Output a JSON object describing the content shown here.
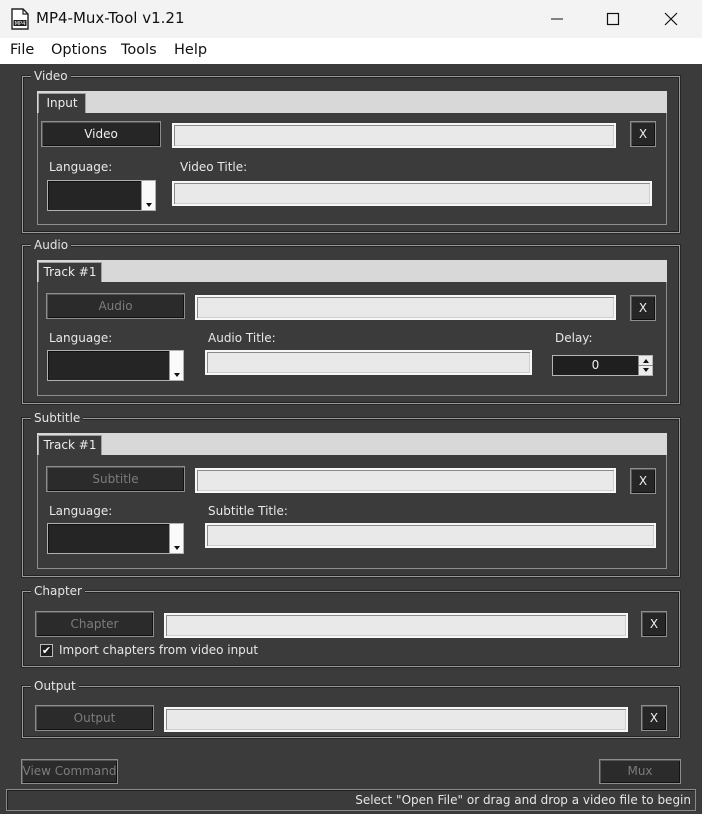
{
  "window": {
    "title": "MP4-Mux-Tool v1.21",
    "app_icon_text": "MP4"
  },
  "menu": [
    "File",
    "Options",
    "Tools",
    "Help"
  ],
  "video": {
    "group_label": "Video",
    "tab_label": "Input",
    "button_label": "Video",
    "clear_label": "X",
    "path_value": "",
    "language_label": "Language:",
    "language_value": "",
    "title_label": "Video Title:",
    "title_value": ""
  },
  "audio": {
    "group_label": "Audio",
    "tab_label": "Track #1",
    "button_label": "Audio",
    "clear_label": "X",
    "path_value": "",
    "language_label": "Language:",
    "language_value": "",
    "title_label": "Audio Title:",
    "title_value": "",
    "delay_label": "Delay:",
    "delay_value": "0"
  },
  "subtitle": {
    "group_label": "Subtitle",
    "tab_label": "Track #1",
    "button_label": "Subtitle",
    "clear_label": "X",
    "path_value": "",
    "language_label": "Language:",
    "language_value": "",
    "title_label": "Subtitle Title:",
    "title_value": ""
  },
  "chapter": {
    "group_label": "Chapter",
    "button_label": "Chapter",
    "clear_label": "X",
    "path_value": "",
    "import_label": "Import chapters from video input",
    "import_checked": true,
    "check_glyph": "✔"
  },
  "output": {
    "group_label": "Output",
    "button_label": "Output",
    "clear_label": "X",
    "path_value": ""
  },
  "footer": {
    "view_command_label": "View Command",
    "mux_label": "Mux"
  },
  "status": {
    "text": "Select \"Open File\" or drag and drop a video file to begin"
  },
  "colors": {
    "background": "#3b3b3b",
    "titlebar": "#f3f3f3",
    "field": "#e9e9e9",
    "button": "#262626"
  },
  "icons": {
    "app": "mp4-file-icon",
    "minimize": "minimize-icon",
    "maximize": "maximize-icon",
    "close": "close-icon",
    "dropdown": "chevron-down-icon",
    "spin": "spin-arrows-icon"
  }
}
